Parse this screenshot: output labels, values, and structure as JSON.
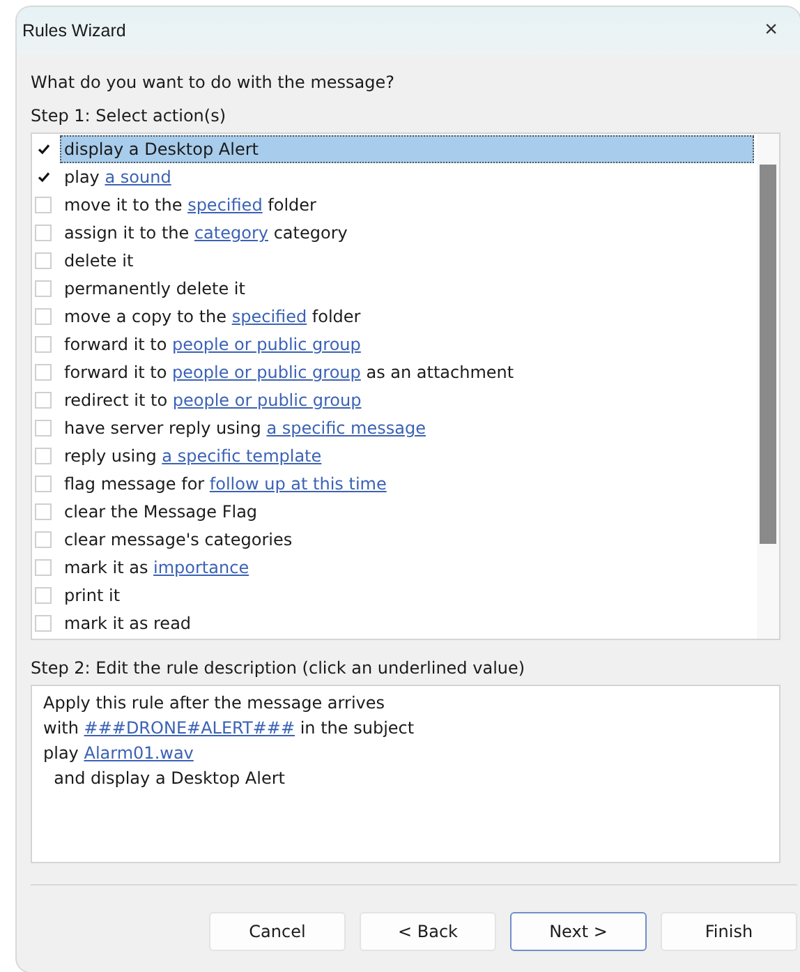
{
  "window": {
    "title": "Rules Wizard",
    "close": "×"
  },
  "question": "What do you want to do with the message?",
  "step1": "Step 1: Select action(s)",
  "actions": [
    {
      "checked": true,
      "selected": true,
      "parts": [
        {
          "kind": "text",
          "text": "display a Desktop Alert"
        }
      ]
    },
    {
      "checked": true,
      "selected": false,
      "parts": [
        {
          "kind": "text",
          "text": "play "
        },
        {
          "kind": "link",
          "text": "a sound"
        }
      ]
    },
    {
      "checked": false,
      "selected": false,
      "parts": [
        {
          "kind": "text",
          "text": "move it to the "
        },
        {
          "kind": "link",
          "text": "specified"
        },
        {
          "kind": "text",
          "text": " folder"
        }
      ]
    },
    {
      "checked": false,
      "selected": false,
      "parts": [
        {
          "kind": "text",
          "text": "assign it to the "
        },
        {
          "kind": "link",
          "text": "category"
        },
        {
          "kind": "text",
          "text": " category"
        }
      ]
    },
    {
      "checked": false,
      "selected": false,
      "parts": [
        {
          "kind": "text",
          "text": "delete it"
        }
      ]
    },
    {
      "checked": false,
      "selected": false,
      "parts": [
        {
          "kind": "text",
          "text": "permanently delete it"
        }
      ]
    },
    {
      "checked": false,
      "selected": false,
      "parts": [
        {
          "kind": "text",
          "text": "move a copy to the "
        },
        {
          "kind": "link",
          "text": "specified"
        },
        {
          "kind": "text",
          "text": " folder"
        }
      ]
    },
    {
      "checked": false,
      "selected": false,
      "parts": [
        {
          "kind": "text",
          "text": "forward it to "
        },
        {
          "kind": "link",
          "text": "people or public group"
        }
      ]
    },
    {
      "checked": false,
      "selected": false,
      "parts": [
        {
          "kind": "text",
          "text": "forward it to "
        },
        {
          "kind": "link",
          "text": "people or public group"
        },
        {
          "kind": "text",
          "text": " as an attachment"
        }
      ]
    },
    {
      "checked": false,
      "selected": false,
      "parts": [
        {
          "kind": "text",
          "text": "redirect it to "
        },
        {
          "kind": "link",
          "text": "people or public group"
        }
      ]
    },
    {
      "checked": false,
      "selected": false,
      "parts": [
        {
          "kind": "text",
          "text": "have server reply using "
        },
        {
          "kind": "link",
          "text": "a specific message"
        }
      ]
    },
    {
      "checked": false,
      "selected": false,
      "parts": [
        {
          "kind": "text",
          "text": "reply using "
        },
        {
          "kind": "link",
          "text": "a specific template"
        }
      ]
    },
    {
      "checked": false,
      "selected": false,
      "parts": [
        {
          "kind": "text",
          "text": "flag message for "
        },
        {
          "kind": "link",
          "text": "follow up at this time"
        }
      ]
    },
    {
      "checked": false,
      "selected": false,
      "parts": [
        {
          "kind": "text",
          "text": "clear the Message Flag"
        }
      ]
    },
    {
      "checked": false,
      "selected": false,
      "parts": [
        {
          "kind": "text",
          "text": "clear message's categories"
        }
      ]
    },
    {
      "checked": false,
      "selected": false,
      "parts": [
        {
          "kind": "text",
          "text": "mark it as "
        },
        {
          "kind": "link",
          "text": "importance"
        }
      ]
    },
    {
      "checked": false,
      "selected": false,
      "parts": [
        {
          "kind": "text",
          "text": "print it"
        }
      ]
    },
    {
      "checked": false,
      "selected": false,
      "parts": [
        {
          "kind": "text",
          "text": "mark it as read"
        }
      ]
    }
  ],
  "step2": "Step 2: Edit the rule description (click an underlined value)",
  "description": [
    {
      "parts": [
        {
          "kind": "text",
          "text": "Apply this rule after the message arrives"
        }
      ]
    },
    {
      "parts": [
        {
          "kind": "text",
          "text": "with "
        },
        {
          "kind": "link",
          "text": "###DRONE#ALERT###"
        },
        {
          "kind": "text",
          "text": " in the subject"
        }
      ]
    },
    {
      "parts": [
        {
          "kind": "text",
          "text": "play "
        },
        {
          "kind": "link",
          "text": "Alarm01.wav"
        }
      ]
    },
    {
      "parts": [
        {
          "kind": "text",
          "text": "  and display a Desktop Alert"
        }
      ]
    }
  ],
  "buttons": [
    {
      "label": "Cancel",
      "default": false
    },
    {
      "label": "< Back",
      "default": false
    },
    {
      "label": "Next >",
      "default": true
    },
    {
      "label": "Finish",
      "default": false
    }
  ]
}
